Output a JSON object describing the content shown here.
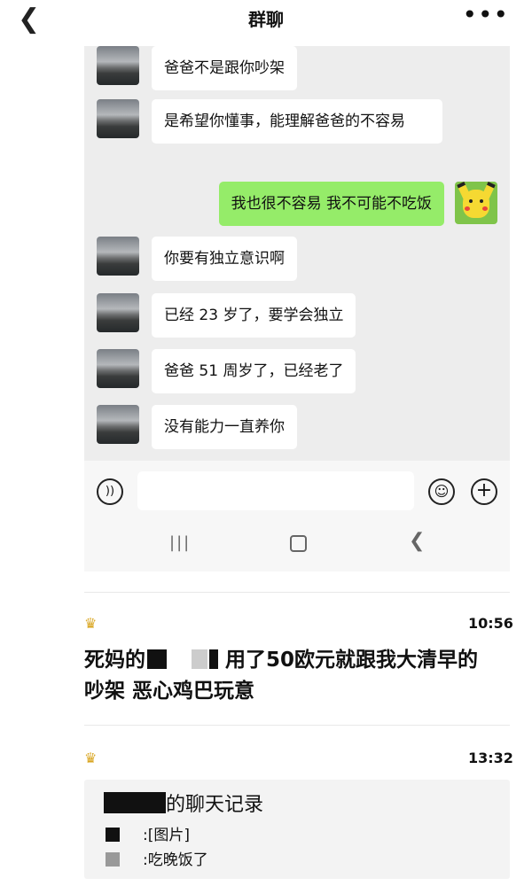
{
  "header": {
    "back_icon": "chevron-left-icon",
    "title": "群聊",
    "more_icon": "more-dots-icon"
  },
  "chat": {
    "messages": [
      {
        "side": "left",
        "text": "爸爸不是跟你吵架"
      },
      {
        "side": "left",
        "text": "是希望你懂事，能理解爸爸的不容易"
      },
      {
        "side": "right",
        "text": "我也很不容易 我不可能不吃饭"
      },
      {
        "side": "left",
        "text": "你要有独立意识啊"
      },
      {
        "side": "left",
        "text": "已经 23 岁了，要学会独立"
      },
      {
        "side": "left",
        "text": "爸爸 51 周岁了，已经老了"
      },
      {
        "side": "left",
        "text": "没有能力一直养你"
      }
    ]
  },
  "input_bar": {
    "voice_icon": "voice-icon",
    "emoji_icon": "emoji-icon",
    "plus_icon": "plus-icon"
  },
  "system_nav": {
    "recent_icon": "recent-apps-icon",
    "home_icon": "home-icon",
    "back_icon": "back-icon"
  },
  "posts": [
    {
      "crown_icon": "crown-icon",
      "time": "10:56",
      "text_part1": "死妈的",
      "text_part2": "用了50欧元就跟我大清早的",
      "text_part3": "吵架 恶心鸡巴玩意"
    },
    {
      "crown_icon": "crown-icon",
      "time": "13:32",
      "forward_title": "的聊天记录",
      "forward_line1": ":[图片]",
      "forward_line2": ":吃晚饭了"
    }
  ]
}
